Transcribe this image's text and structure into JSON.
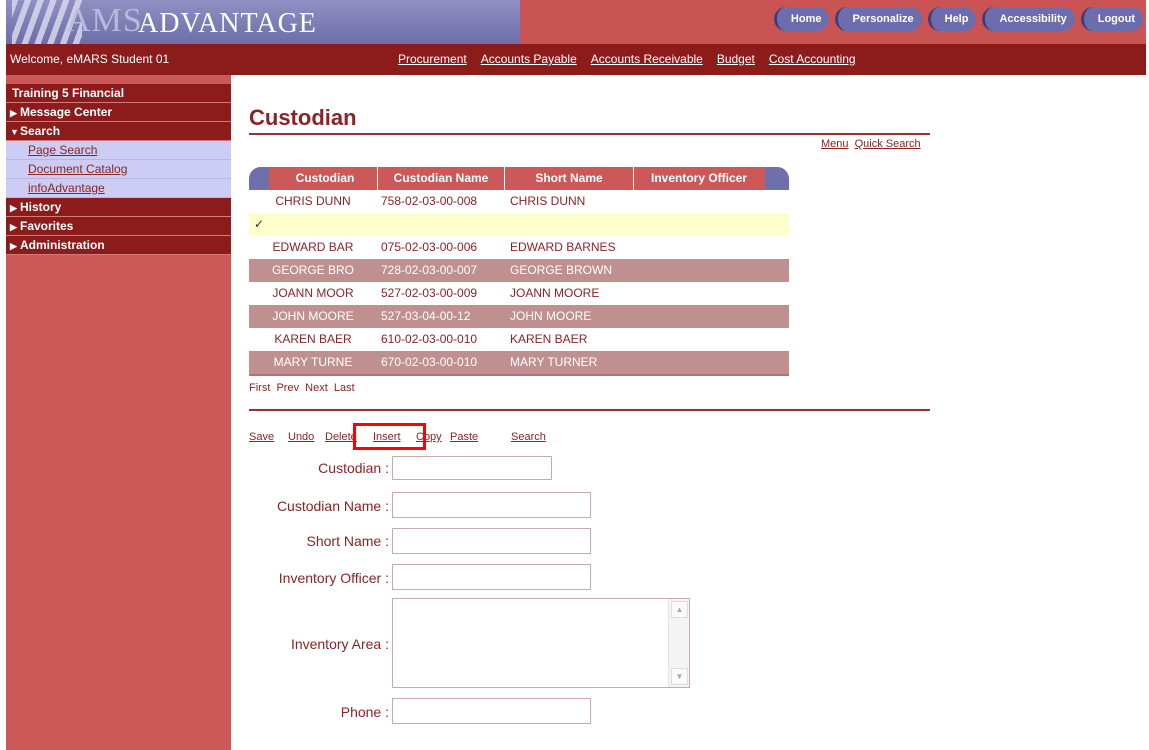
{
  "header": {
    "logo_ams": "AMS",
    "logo_advantage": "ADVANTAGE",
    "nav": [
      "Home",
      "Personalize",
      "Help",
      "Accessibility",
      "Logout"
    ],
    "welcome": "Welcome, eMARS Student 01",
    "modules": [
      "Procurement",
      "Accounts Payable",
      "Accounts Receivable",
      "Budget",
      "Cost Accounting"
    ]
  },
  "sidebar": {
    "title": "Training 5 Financial",
    "sections": [
      {
        "label": "Message Center",
        "expanded": false
      },
      {
        "label": "Search",
        "expanded": true,
        "items": [
          "Page Search",
          "Document Catalog",
          "infoAdvantage"
        ]
      },
      {
        "label": "History",
        "expanded": false
      },
      {
        "label": "Favorites",
        "expanded": false
      },
      {
        "label": "Administration",
        "expanded": false
      }
    ]
  },
  "main": {
    "title": "Custodian",
    "quick_links": [
      "Menu",
      "Quick Search"
    ],
    "grid": {
      "columns": [
        "Custodian",
        "Custodian Name",
        "Short Name",
        "Inventory Officer"
      ],
      "selected_mark": "✓",
      "rows": [
        [
          "CHRIS DUNN",
          "758-02-03-00-008",
          "CHRIS DUNN",
          ""
        ],
        [
          "EDWARD BAR",
          "075-02-03-00-006",
          "EDWARD BARNES",
          ""
        ],
        [
          "GEORGE BRO",
          "728-02-03-00-007",
          "GEORGE BROWN",
          ""
        ],
        [
          "JOANN MOOR",
          "527-02-03-00-009",
          "JOANN MOORE",
          ""
        ],
        [
          "JOHN MOORE",
          "527-03-04-00-12",
          "JOHN MOORE",
          ""
        ],
        [
          "KAREN BAER",
          "610-02-03-00-010",
          "KAREN BAER",
          ""
        ],
        [
          "MARY TURNE",
          "670-02-03-00-010",
          "MARY TURNER",
          ""
        ]
      ],
      "pager": [
        "First",
        "Prev",
        "Next",
        "Last"
      ]
    },
    "toolbar": [
      "Save",
      "Undo",
      "Delete",
      "Insert",
      "Copy",
      "Paste",
      "Search"
    ],
    "form": {
      "custodian": {
        "label": "Custodian :",
        "value": ""
      },
      "custodian_name": {
        "label": "Custodian Name :",
        "value": ""
      },
      "short_name": {
        "label": "Short Name :",
        "value": ""
      },
      "inventory_officer": {
        "label": "Inventory Officer :",
        "value": ""
      },
      "inventory_area": {
        "label": "Inventory Area :",
        "value": ""
      },
      "phone": {
        "label": "Phone :",
        "value": ""
      }
    }
  },
  "colors": {
    "brand_red": "#cc5858",
    "dark_red": "#8c1c1c",
    "accent_purple": "#6d6dad",
    "highlight": "#ff0000"
  }
}
